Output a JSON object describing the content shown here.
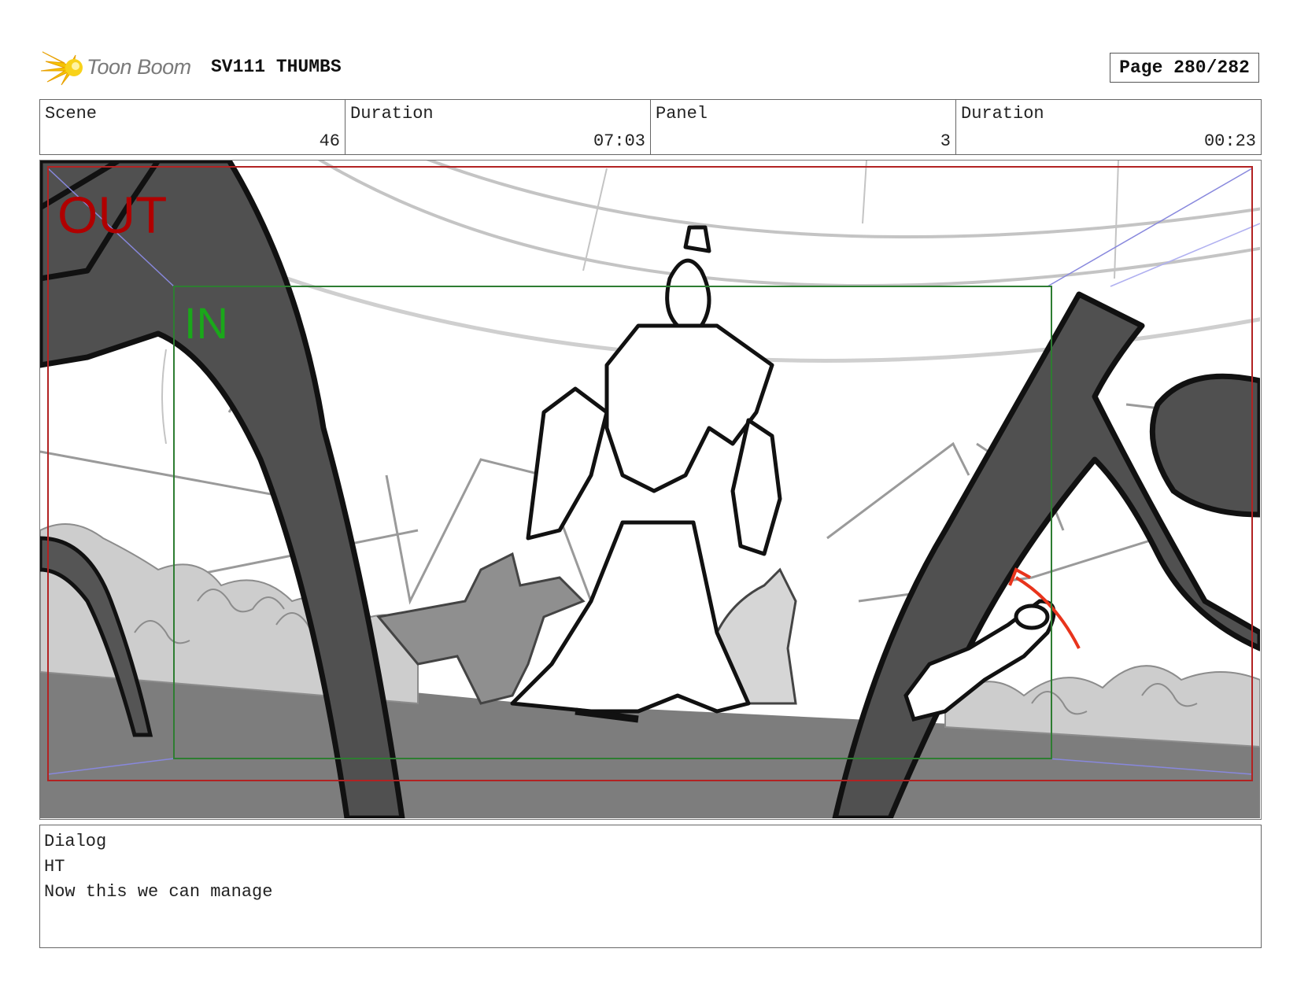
{
  "header": {
    "logo_text": "Toon Boom",
    "project_title": "SV111 THUMBS",
    "page_label": "Page 280/282"
  },
  "info": {
    "scene_label": "Scene",
    "scene_value": "46",
    "scene_duration_label": "Duration",
    "scene_duration_value": "07:03",
    "panel_label": "Panel",
    "panel_value": "3",
    "panel_duration_label": "Duration",
    "panel_duration_value": "00:23"
  },
  "panel": {
    "out_label": "OUT",
    "in_label": "IN",
    "colors": {
      "out_frame": "#b22222",
      "in_frame": "#2e7d32",
      "out_text": "#b00000",
      "in_text": "#1aa81a",
      "arrow": "#e8341c"
    }
  },
  "dialog": {
    "label": "Dialog",
    "speaker": "HT",
    "line": "Now this we can manage"
  }
}
